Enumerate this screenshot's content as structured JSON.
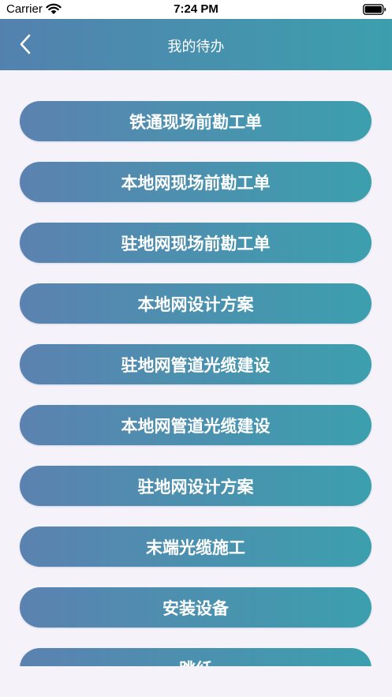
{
  "status_bar": {
    "carrier": "Carrier",
    "time": "7:24 PM"
  },
  "nav": {
    "title": "我的待办",
    "back_icon": "chevron-left-icon"
  },
  "menu_items": [
    {
      "label": "铁通现场前勘工单"
    },
    {
      "label": "本地网现场前勘工单"
    },
    {
      "label": "驻地网现场前勘工单"
    },
    {
      "label": "本地网设计方案"
    },
    {
      "label": "驻地网管道光缆建设"
    },
    {
      "label": "本地网管道光缆建设"
    },
    {
      "label": "驻地网设计方案"
    },
    {
      "label": "末端光缆施工"
    },
    {
      "label": "安装设备"
    },
    {
      "label": "跳纤"
    }
  ],
  "colors": {
    "nav_gradient_start": "#5381ae",
    "nav_gradient_end": "#3c9fad",
    "button_gradient_start": "#5b82b0",
    "button_gradient_end": "#3c9fae",
    "background": "#f5f2fa"
  }
}
